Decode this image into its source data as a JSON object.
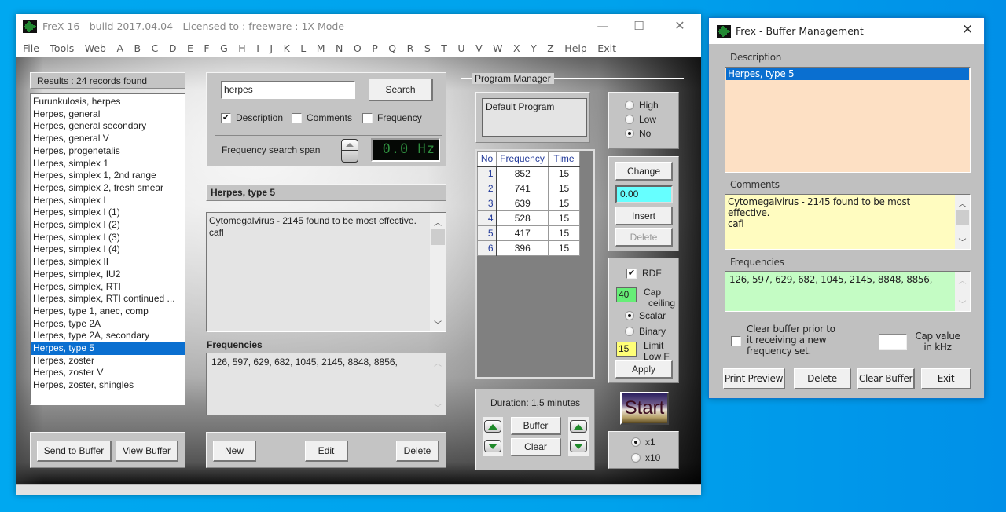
{
  "main_window": {
    "title": "FreX 16 - build 2017.04.04 - Licensed to : freeware  :  1X Mode",
    "controls": {
      "minimize": "—",
      "maximize": "☐",
      "close": "✕"
    },
    "menu": [
      "File",
      "Tools",
      "Web",
      "A",
      "B",
      "C",
      "D",
      "E",
      "F",
      "G",
      "H",
      "I",
      "J",
      "K",
      "L",
      "M",
      "N",
      "O",
      "P",
      "Q",
      "R",
      "S",
      "T",
      "U",
      "V",
      "W",
      "X",
      "Y",
      "Z",
      "Help",
      "Exit"
    ],
    "results": {
      "header": "Results :  24 records found",
      "items": [
        "Furunkulosis, herpes",
        "Herpes, general",
        "Herpes, general secondary",
        "Herpes, general V",
        "Herpes, progenetalis",
        "Herpes, simplex 1",
        "Herpes, simplex 1, 2nd range",
        "Herpes, simplex 2, fresh smear",
        "Herpes, simplex I",
        "Herpes, simplex I (1)",
        "Herpes, simplex I (2)",
        "Herpes, simplex I (3)",
        "Herpes, simplex I (4)",
        "Herpes, simplex II",
        "Herpes, simplex, IU2",
        "Herpes, simplex, RTI",
        "Herpes, simplex, RTI continued ...",
        "Herpes, type 1, anec, comp",
        "Herpes, type 2A",
        "Herpes, type 2A, secondary",
        "Herpes, type 5",
        "Herpes, zoster",
        "Herpes, zoster V",
        "Herpes, zoster, shingles"
      ],
      "selected_index": 20,
      "send_to_buffer": "Send to Buffer",
      "view_buffer": "View Buffer"
    },
    "search": {
      "value": "herpes",
      "button": "Search",
      "options": [
        {
          "label": "Description",
          "checked": true
        },
        {
          "label": "Comments",
          "checked": false
        },
        {
          "label": "Frequency",
          "checked": false
        }
      ],
      "span_label": "Frequency search span",
      "span_value": "0.0 Hz"
    },
    "record": {
      "title": "Herpes, type 5",
      "comments": "Cytomegalvirus - 2145 found to be most effective.\ncafl",
      "frequencies_label": "Frequencies",
      "frequencies": "126,  597,  629,  682,  1045,  2145,  8848,  8856,",
      "new": "New",
      "edit": "Edit",
      "delete": "Delete"
    },
    "program_manager": {
      "title": "Program Manager",
      "program_name": "Default Program",
      "level_options": [
        {
          "label": "High",
          "checked": false
        },
        {
          "label": "Low",
          "checked": false
        },
        {
          "label": "No",
          "checked": true
        }
      ],
      "table": {
        "headers": [
          "No",
          "Frequency",
          "Time"
        ],
        "rows": [
          [
            "1",
            "852",
            "15"
          ],
          [
            "2",
            "741",
            "15"
          ],
          [
            "3",
            "639",
            "15"
          ],
          [
            "4",
            "528",
            "15"
          ],
          [
            "5",
            "417",
            "15"
          ],
          [
            "6",
            "396",
            "15"
          ]
        ]
      },
      "change": "Change",
      "value_field": "0.00",
      "insert": "Insert",
      "delete": "Delete",
      "rdf": {
        "label": "RDF",
        "checked": true
      },
      "cap_value": "40",
      "cap_label_1": "Cap",
      "cap_label_2": "ceiling",
      "mode_options": [
        {
          "label": "Scalar",
          "checked": true
        },
        {
          "label": "Binary",
          "checked": false
        }
      ],
      "limit_value": "15",
      "limit_label_1": "Limit",
      "limit_label_2": "Low F",
      "apply": "Apply",
      "duration": "Duration: 1,5 minutes",
      "buffer": "Buffer",
      "clear": "Clear",
      "start": "Start",
      "multiplier_options": [
        {
          "label": "x1",
          "checked": true
        },
        {
          "label": "x10",
          "checked": false
        }
      ]
    }
  },
  "buffer_window": {
    "title": "Frex - Buffer Management",
    "close": "✕",
    "description_label": "Description",
    "description_items": [
      "Herpes, type 5"
    ],
    "comments_label": "Comments",
    "comments": "Cytomegalvirus - 2145 found to be most effective.\ncafl",
    "frequencies_label": "Frequencies",
    "frequencies": "126,  597,  629,  682,  1045,  2145,  8848,  8856,",
    "clear_prior_label": "Clear buffer prior to it receiving a new frequency set.",
    "clear_prior_checked": false,
    "cap_value": "",
    "cap_label": "Cap value in kHz",
    "buttons": {
      "print_preview": "Print Preview",
      "delete": "Delete",
      "clear_buffer": "Clear Buffer",
      "exit": "Exit"
    },
    "colors": {
      "description_bg": "#fde0c4",
      "comments_bg": "#fffcc0",
      "frequencies_bg": "#c4fcc4"
    }
  },
  "colors": {
    "desktop": "#00a8f0",
    "selection": "#0a6fd0",
    "value_field": "#66ffff",
    "cap_field": "#66ee77",
    "limit_field": "#ffff77",
    "lcd_text": "#2f8f3f"
  }
}
